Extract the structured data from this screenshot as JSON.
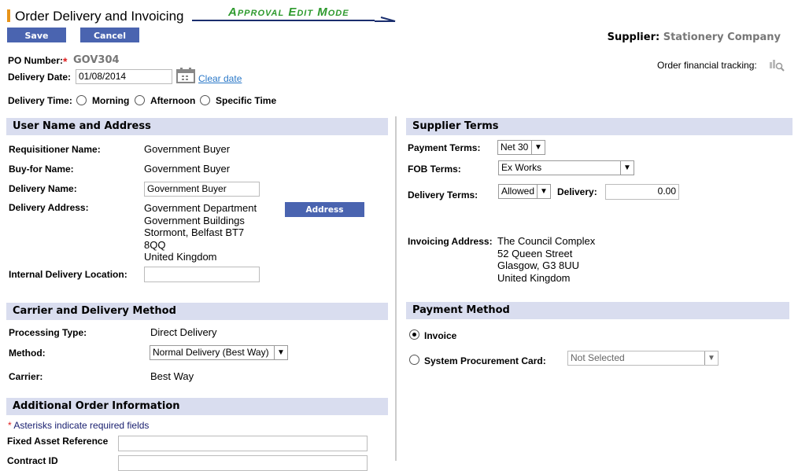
{
  "page": {
    "title": "Order Delivery and Invoicing",
    "mode": "Approval Edit Mode",
    "accent": "#e8941a",
    "mode_color": "#2e9a2e"
  },
  "toolbar": {
    "save": "Save",
    "cancel": "Cancel"
  },
  "supplier": {
    "label": "Supplier:",
    "value": "Stationery Company"
  },
  "tracking": {
    "label": "Order financial tracking:",
    "icon": "search-chart-icon"
  },
  "po": {
    "label": "PO Number:",
    "required": "*",
    "value": "GOV304"
  },
  "delivery_date": {
    "label": "Delivery Date:",
    "value": "01/08/2014",
    "clear": "Clear date",
    "icon": "calendar-icon"
  },
  "delivery_time": {
    "label": "Delivery Time:",
    "options": [
      "Morning",
      "Afternoon",
      "Specific Time"
    ]
  },
  "user": {
    "header": "User Name and Address",
    "requisitioner_label": "Requisitioner Name:",
    "requisitioner": "Government Buyer",
    "buyfor_label": "Buy-for Name:",
    "buyfor": "Government Buyer",
    "delivery_name_label": "Delivery Name:",
    "delivery_name": "Government Buyer",
    "address_label": "Delivery Address:",
    "address": [
      "Government Department",
      "Government Buildings",
      "Stormont, Belfast BT7",
      "8QQ",
      "United Kingdom"
    ],
    "lookup": "Address Lookup",
    "internal_label": "Internal Delivery Location:",
    "internal": ""
  },
  "carrier": {
    "header": "Carrier and Delivery Method",
    "processing_label": "Processing Type:",
    "processing": "Direct Delivery",
    "method_label": "Method:",
    "method": "Normal Delivery (Best Way)",
    "carrier_label": "Carrier:",
    "carrier": "Best Way"
  },
  "additional": {
    "header": "Additional Order Information",
    "required_star": "*",
    "required_note": "Asterisks indicate required fields",
    "fixed_asset_label": "Fixed Asset Reference",
    "fixed_asset": "",
    "contract_label": "Contract ID",
    "contract": ""
  },
  "terms": {
    "header": "Supplier Terms",
    "payment_label": "Payment Terms:",
    "payment": "Net 30",
    "fob_label": "FOB Terms:",
    "fob": "Ex Works",
    "delivery_terms_label": "Delivery Terms:",
    "delivery_terms": "Allowed",
    "delivery_label": "Delivery:",
    "delivery": "0.00",
    "invoice_label": "Invoicing Address:",
    "invoice_address": [
      "The Council Complex",
      "52 Queen Street",
      "Glasgow, G3 8UU",
      "United Kingdom"
    ]
  },
  "payment": {
    "header": "Payment Method",
    "invoice": "Invoice",
    "invoice_selected": true,
    "card": "System Procurement Card:",
    "card_value": "Not Selected"
  }
}
